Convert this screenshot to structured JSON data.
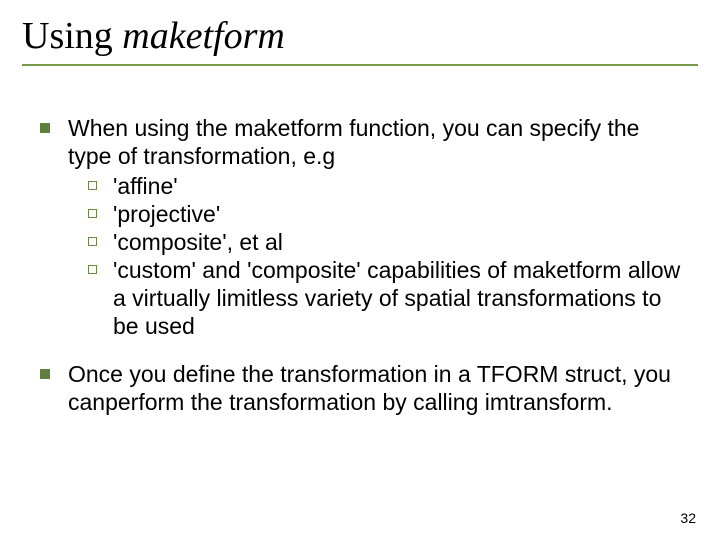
{
  "title": {
    "prefix": "Using ",
    "italic": "maketform"
  },
  "bullets": [
    {
      "text": "When using the maketform function, you can specify the type of transformation, e.g",
      "sub": [
        "'affine'",
        "'projective'",
        "'composite',  et al",
        "'custom' and 'composite' capabilities of maketform allow a virtually limitless variety of spatial transformations to be used"
      ]
    },
    {
      "text": "Once you define the transformation in a TFORM struct, you canperform the transformation by calling imtransform.",
      "sub": []
    }
  ],
  "page_number": "32"
}
